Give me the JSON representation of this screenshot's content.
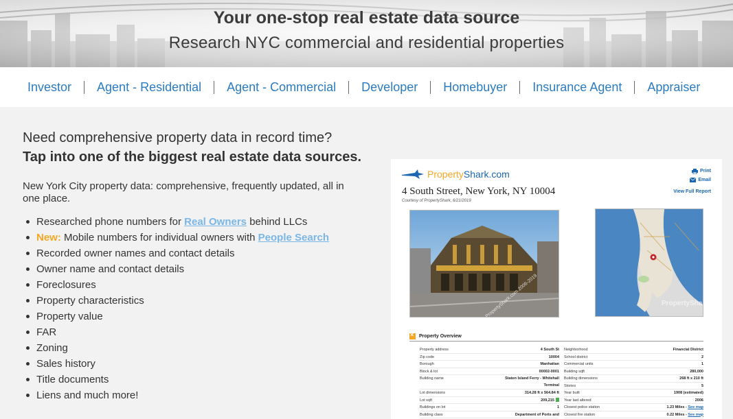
{
  "hero": {
    "headline": "Your one-stop real estate data source",
    "subheadline": "Research NYC commercial and residential properties"
  },
  "nav": {
    "items": [
      "Investor",
      "Agent - Residential",
      "Agent - Commercial",
      "Developer",
      "Homebuyer",
      "Insurance Agent",
      "Appraiser"
    ]
  },
  "content": {
    "intro_line": "Need comprehensive property data in record time?",
    "intro_bold": "Tap into one of the biggest real estate data sources.",
    "description": "New York City property data: comprehensive, frequently updated, all in one place.",
    "features": {
      "phone_prefix": "Researched phone numbers for",
      "phone_link": "Real Owners",
      "phone_suffix": "behind LLCs",
      "new_label": "New:",
      "mobile_prefix": "Mobile numbers for individual owners with",
      "mobile_link": "People Search",
      "items": [
        "Recorded owner names and contact details",
        "Owner name and contact details",
        "Foreclosures",
        "Property characteristics",
        "Property value",
        "FAR",
        "Zoning",
        "Sales history",
        "Title documents",
        "Liens and much more!"
      ]
    }
  },
  "report": {
    "brand_main": "Property",
    "brand_accent": "Shark.com",
    "address": "4 South Street, New York, NY 10004",
    "courtesy": "Courtesy of PropertyShark, 6/21/2019",
    "print_label": "Print",
    "email_label": "Email",
    "full_report_label": "View Full Report",
    "photo_watermark": "© PropertyShark.com 2006-2019",
    "map_watermark": "PropertyShark",
    "overview_title": "Property Overview",
    "left_rows": [
      {
        "label": "Property address",
        "value": "4 South St"
      },
      {
        "label": "Zip code",
        "value": "10004"
      },
      {
        "label": "Borough",
        "value": "Manhattan"
      },
      {
        "label": "Block & lot",
        "value": "00002-0001"
      },
      {
        "label": "Building name",
        "value": "Staten Island Ferry - Whitehall Terminal"
      },
      {
        "label": "Lot dimensions",
        "value": "314.28 ft x 564.84 ft"
      },
      {
        "label": "Lot sqft",
        "value": "209,215"
      },
      {
        "label": "Buildings on lot",
        "value": "1"
      },
      {
        "label": "Building class",
        "value": "Department of Ports and Terminals (KC)"
      }
    ],
    "right_rows": [
      {
        "label": "Neighborhood",
        "value": "Financial District"
      },
      {
        "label": "School district",
        "value": "2"
      },
      {
        "label": "Commercial units",
        "value": "1"
      },
      {
        "label": "Building sqft",
        "value": "280,000"
      },
      {
        "label": "Building dimensions",
        "value": "268 ft x 210 ft"
      },
      {
        "label": "Stories",
        "value": "5"
      },
      {
        "label": "Year built",
        "value": "1908 (estimated)"
      },
      {
        "label": "Year last altered",
        "value": "2006"
      },
      {
        "label": "Closest police station",
        "value": "1.23 Miles",
        "link": "See map"
      },
      {
        "label": "Closest fire station",
        "value": "0.22 Miles",
        "link": "See map"
      }
    ]
  },
  "colors": {
    "nav_link": "#2b7bbf",
    "feature_link": "#7ab6e6",
    "new_badge": "#f5a623",
    "brand_blue": "#1b66b1"
  }
}
